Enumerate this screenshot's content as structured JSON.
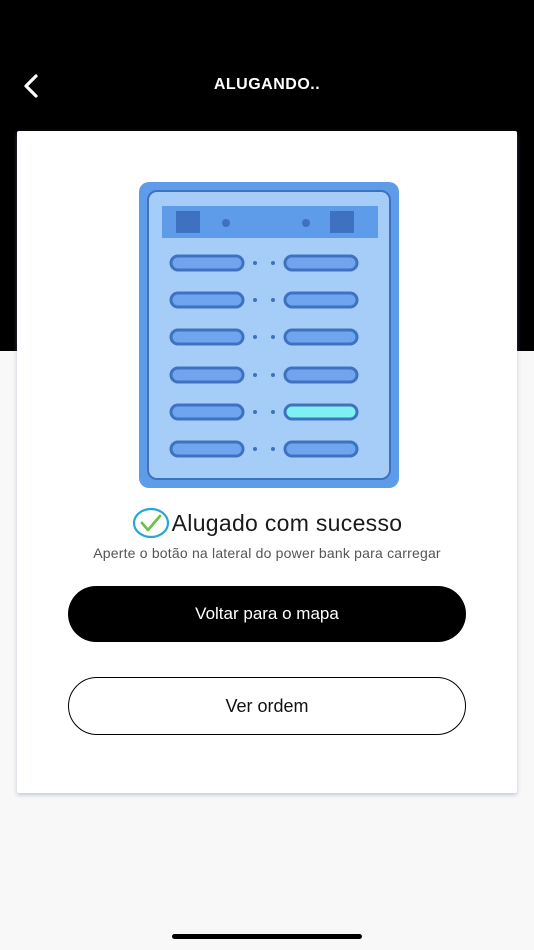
{
  "header": {
    "title": "ALUGANDO..",
    "back_icon": "chevron-left-icon"
  },
  "illustration": {
    "icon": "power-bank-station-icon",
    "colors": {
      "outer": "#5e9be8",
      "panel": "#a5cdf8",
      "slot": "#6ea5ee",
      "slot_border": "#3e72c0",
      "active_slot": "#7ff0f0"
    }
  },
  "status": {
    "icon": "check-circle-icon",
    "title": "Alugado com sucesso",
    "subtitle": "Aperte o botão na lateral do power bank para carregar"
  },
  "actions": {
    "primary_label": "Voltar para o mapa",
    "secondary_label": "Ver ordem"
  },
  "colors": {
    "header_bg": "#000000",
    "check_circle": "#2aa6d6",
    "check_mark": "#6cc24a"
  }
}
